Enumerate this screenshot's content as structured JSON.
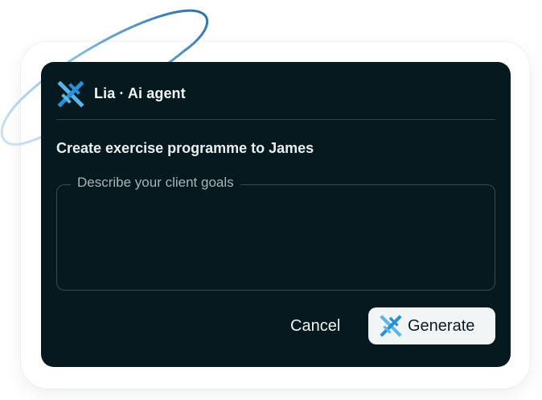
{
  "dialog": {
    "logo_icon": "lia-logo-icon",
    "title": "Lia · Ai agent",
    "prompt": "Create exercise programme to James",
    "goals_field": {
      "label": "Describe your client goals",
      "value": ""
    },
    "actions": {
      "cancel_label": "Cancel",
      "generate_label": "Generate",
      "generate_icon": "lia-logo-icon"
    }
  },
  "colors": {
    "dialog_background": "#06191e",
    "accent_blue": "#2a8fd6",
    "accent_light_blue": "#5ab6ea",
    "button_background": "#f2f5f6"
  }
}
